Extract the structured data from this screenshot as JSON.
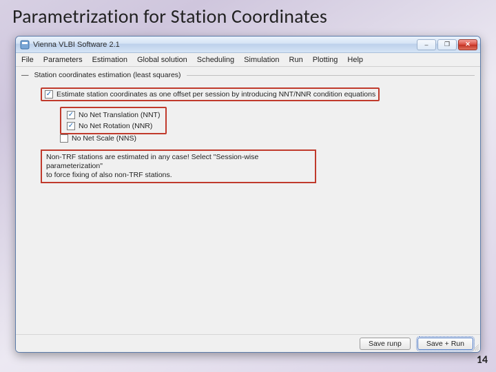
{
  "slide": {
    "title": "Parametrization for Station Coordinates",
    "page_number": "14"
  },
  "window": {
    "app_title": "Vienna VLBI Software 2.1",
    "buttons": {
      "min": "–",
      "max": "❐",
      "close": "✕"
    }
  },
  "menu": {
    "items": [
      "File",
      "Parameters",
      "Estimation",
      "Global solution",
      "Scheduling",
      "Simulation",
      "Run",
      "Plotting",
      "Help"
    ]
  },
  "panel": {
    "group_title": "Station coordinates estimation (least squares)",
    "estimate_chk": {
      "checked": true,
      "label": "Estimate station coordinates as one offset per session by introducing NNT/NNR condition equations"
    },
    "nnt_chk": {
      "checked": true,
      "label": "No Net Translation (NNT)"
    },
    "nnr_chk": {
      "checked": true,
      "label": "No Net Rotation (NNR)"
    },
    "nns_chk": {
      "checked": false,
      "label": "No Net Scale (NNS)"
    },
    "note_line1": "Non-TRF stations are estimated in any case! Select \"Session-wise parameterization\"",
    "note_line2": "to force fixing of also non-TRF stations."
  },
  "footer": {
    "save_runp_label": "Save runp",
    "save_run_label": "Save + Run"
  }
}
